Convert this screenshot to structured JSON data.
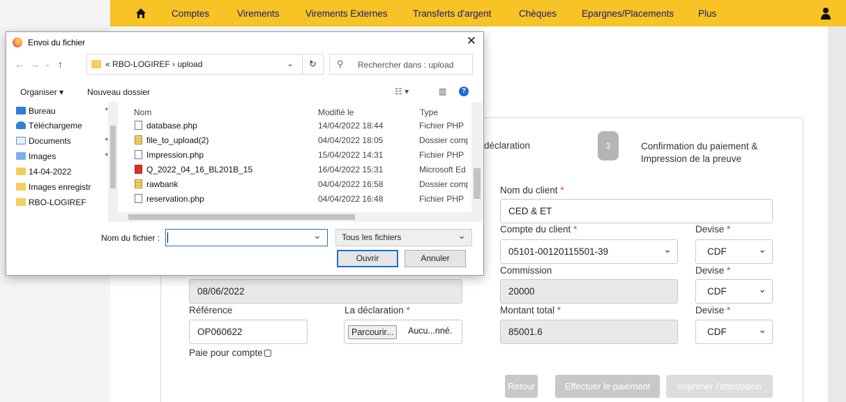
{
  "nav": {
    "items": [
      "Comptes",
      "Virements",
      "Virements Externes",
      "Transferts d'argent",
      "Chèques",
      "Epargnes/Placements",
      "Plus"
    ]
  },
  "steps": {
    "step2_partial": "déclaration",
    "step3_number": "3",
    "step3_line1": "Confirmation du paiement &",
    "step3_line2": "Impression de la preuve"
  },
  "form": {
    "client_name_label": "Nom du client",
    "client_name_value": "CED & ET",
    "client_account_label": "Compte du client",
    "client_account_value": "05101-00120115501-39",
    "currency_label": "Devise",
    "currency_value": "CDF",
    "commission_label": "Commission",
    "commission_value": "20000",
    "date_value": "08/06/2022",
    "reference_label": "Référence",
    "reference_value": "OP060622",
    "declaration_label": "La déclaration",
    "browse_label": "Parcourir...",
    "file_status": "Aucu...nné.",
    "total_label": "Montant total",
    "total_value": "85001.6",
    "pay_for_account_label": "Paie pour compte",
    "required_mark": "*",
    "back_label": "Retour",
    "pay_label": "Effectuer le paiement",
    "print_label": "Imprimer l'attestation"
  },
  "dialog": {
    "title": "Envoi du fichier",
    "path_prefix": "«",
    "path": "RBO-LOGIREF  ›  upload",
    "search_placeholder": "Rechercher dans : upload",
    "organize_label": "Organiser ▾",
    "new_folder_label": "Nouveau dossier",
    "tree": [
      "Bureau",
      "Téléchargeme",
      "Documents",
      "Images",
      "14-04-2022",
      "Images enregistr",
      "RBO-LOGIREF"
    ],
    "columns": {
      "name": "Nom",
      "modified": "Modifié le",
      "type": "Type"
    },
    "files": [
      {
        "name": "database.php",
        "modified": "14/04/2022 18:44",
        "type": "Fichier PHP",
        "icon": "file"
      },
      {
        "name": "file_to_upload(2)",
        "modified": "04/04/2022 18:05",
        "type": "Dossier comp",
        "icon": "zip"
      },
      {
        "name": "Impression.php",
        "modified": "15/04/2022 14:31",
        "type": "Fichier PHP",
        "icon": "file"
      },
      {
        "name": "Q_2022_04_16_BL201B_15",
        "modified": "16/04/2022 15:31",
        "type": "Microsoft Ed",
        "icon": "pdf"
      },
      {
        "name": "rawbank",
        "modified": "04/04/2022 16:58",
        "type": "Dossier comp",
        "icon": "zip"
      },
      {
        "name": "reservation.php",
        "modified": "04/04/2022 16:48",
        "type": "Fichier PHP",
        "icon": "file"
      }
    ],
    "filename_label": "Nom du fichier :",
    "filetype_value": "Tous les fichiers",
    "open_label": "Ouvrir",
    "cancel_label": "Annuler"
  },
  "colors": {
    "nav": "#f7c325",
    "nav_text": "#1a1a6e",
    "required": "#e0343b",
    "focus": "#1e6ad6"
  }
}
